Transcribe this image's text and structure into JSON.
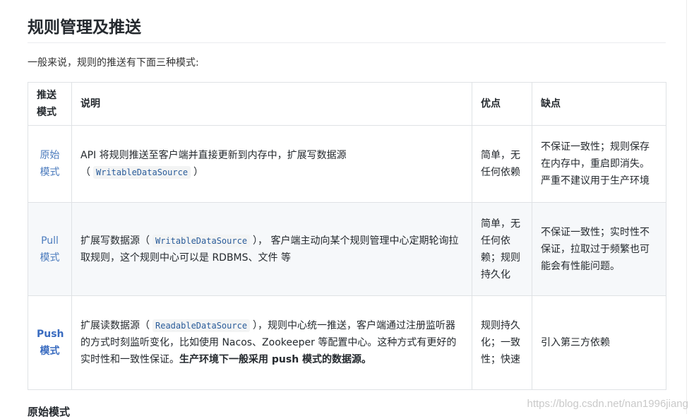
{
  "heading": "规则管理及推送",
  "intro": "一般来说，规则的推送有下面三种模式:",
  "table": {
    "headers": {
      "mode": "推送模式",
      "desc": "说明",
      "pros": "优点",
      "cons": "缺点"
    },
    "rows": [
      {
        "mode": "原始模式",
        "desc_pre": "API 将规则推送至客户端并直接更新到内存中，扩展写数据源（",
        "desc_code": "WritableDataSource",
        "desc_post": "）",
        "desc_bold": "",
        "pros": "简单，无任何依赖",
        "cons": "不保证一致性；规则保存在内存中，重启即消失。严重不建议用于生产环境"
      },
      {
        "mode": "Pull 模式",
        "desc_pre": "扩展写数据源（",
        "desc_code": "WritableDataSource",
        "desc_post": "）， 客户端主动向某个规则管理中心定期轮询拉取规则，这个规则中心可以是 RDBMS、文件 等",
        "desc_bold": "",
        "pros": "简单，无任何依赖；规则持久化",
        "cons": "不保证一致性；实时性不保证，拉取过于频繁也可能会有性能问题。"
      },
      {
        "mode": "Push 模式",
        "desc_pre": "扩展读数据源（",
        "desc_code": "ReadableDataSource",
        "desc_post": "），规则中心统一推送，客户端通过注册监听器的方式时刻监听变化，比如使用 Nacos、Zookeeper 等配置中心。这种方式有更好的实时性和一致性保证。",
        "desc_bold": "生产环境下一般采用 push 模式的数据源。",
        "pros": "规则持久化；一致性；快速",
        "cons": "引入第三方依赖"
      }
    ]
  },
  "next_heading": "原始模式",
  "watermark": "https://blog.csdn.net/nan1996jiang"
}
